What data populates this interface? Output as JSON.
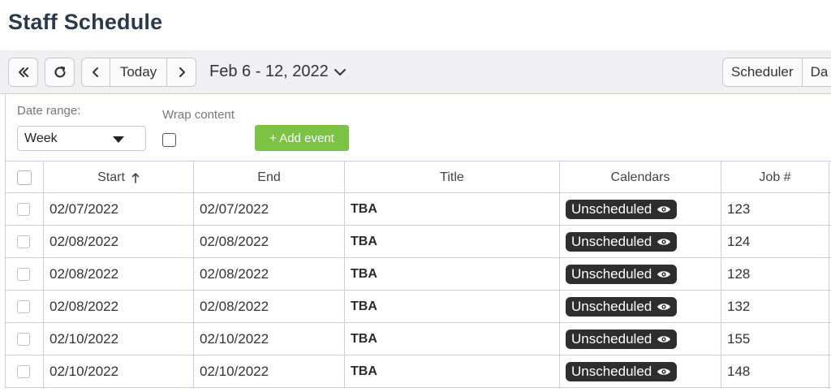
{
  "page": {
    "title": "Staff Schedule"
  },
  "toolbar": {
    "today_label": "Today",
    "date_range_text": "Feb 6 - 12, 2022",
    "views": [
      "Scheduler",
      "Da"
    ]
  },
  "filters": {
    "date_range_label": "Date range:",
    "date_range_value": "Week",
    "wrap_content_label": "Wrap content",
    "add_event_label": "+ Add event"
  },
  "table": {
    "headers": {
      "start": "Start",
      "end": "End",
      "title": "Title",
      "calendars": "Calendars",
      "job": "Job #"
    },
    "rows": [
      {
        "start": "02/07/2022",
        "end": "02/07/2022",
        "title": "TBA",
        "calendar": "Unscheduled",
        "job": "123"
      },
      {
        "start": "02/08/2022",
        "end": "02/08/2022",
        "title": "TBA",
        "calendar": "Unscheduled",
        "job": "124"
      },
      {
        "start": "02/08/2022",
        "end": "02/08/2022",
        "title": "TBA",
        "calendar": "Unscheduled",
        "job": "128"
      },
      {
        "start": "02/08/2022",
        "end": "02/08/2022",
        "title": "TBA",
        "calendar": "Unscheduled",
        "job": "132"
      },
      {
        "start": "02/10/2022",
        "end": "02/10/2022",
        "title": "TBA",
        "calendar": "Unscheduled",
        "job": "155"
      },
      {
        "start": "02/10/2022",
        "end": "02/10/2022",
        "title": "TBA",
        "calendar": "Unscheduled",
        "job": "148"
      }
    ]
  },
  "colors": {
    "accent_green": "#7cc245",
    "badge_dark": "#2e2e2e",
    "grid_line": "#c9cbe8"
  },
  "icons": [
    "double-chevron-left-icon",
    "refresh-icon",
    "chevron-left-icon",
    "chevron-right-icon",
    "chevron-down-icon",
    "sort-up-arrow-icon",
    "eye-icon",
    "dropdown-caret-icon"
  ]
}
